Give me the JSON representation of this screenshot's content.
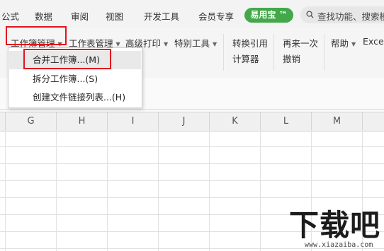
{
  "menubar": {
    "items": [
      "公式",
      "数据",
      "审阅",
      "视图",
      "开发工具",
      "会员专享"
    ],
    "promo_label": "易用宝 ™",
    "search_placeholder": "查找功能、搜索模"
  },
  "ribbon": {
    "workbook_mgmt": "工作簿管理",
    "sheet_mgmt": "工作表管理",
    "advanced_print": "高级打印",
    "special_tools": "特别工具",
    "convert_ref": "转换引用",
    "calculator": "计算器",
    "redo_once": "再来一次",
    "undo": "撤销",
    "help": "帮助",
    "excel": "Excel"
  },
  "dropdown": {
    "items": [
      "合并工作簿...(M)",
      "拆分工作簿...(S)",
      "创建文件链接列表...(H)"
    ]
  },
  "columns": [
    "G",
    "H",
    "I",
    "J",
    "K",
    "L",
    "M"
  ],
  "watermark": {
    "logo_text": "下载吧",
    "url": "www.xiazaiba.com"
  },
  "colors": {
    "highlight": "#e0151e",
    "promo": "#42a84a"
  }
}
